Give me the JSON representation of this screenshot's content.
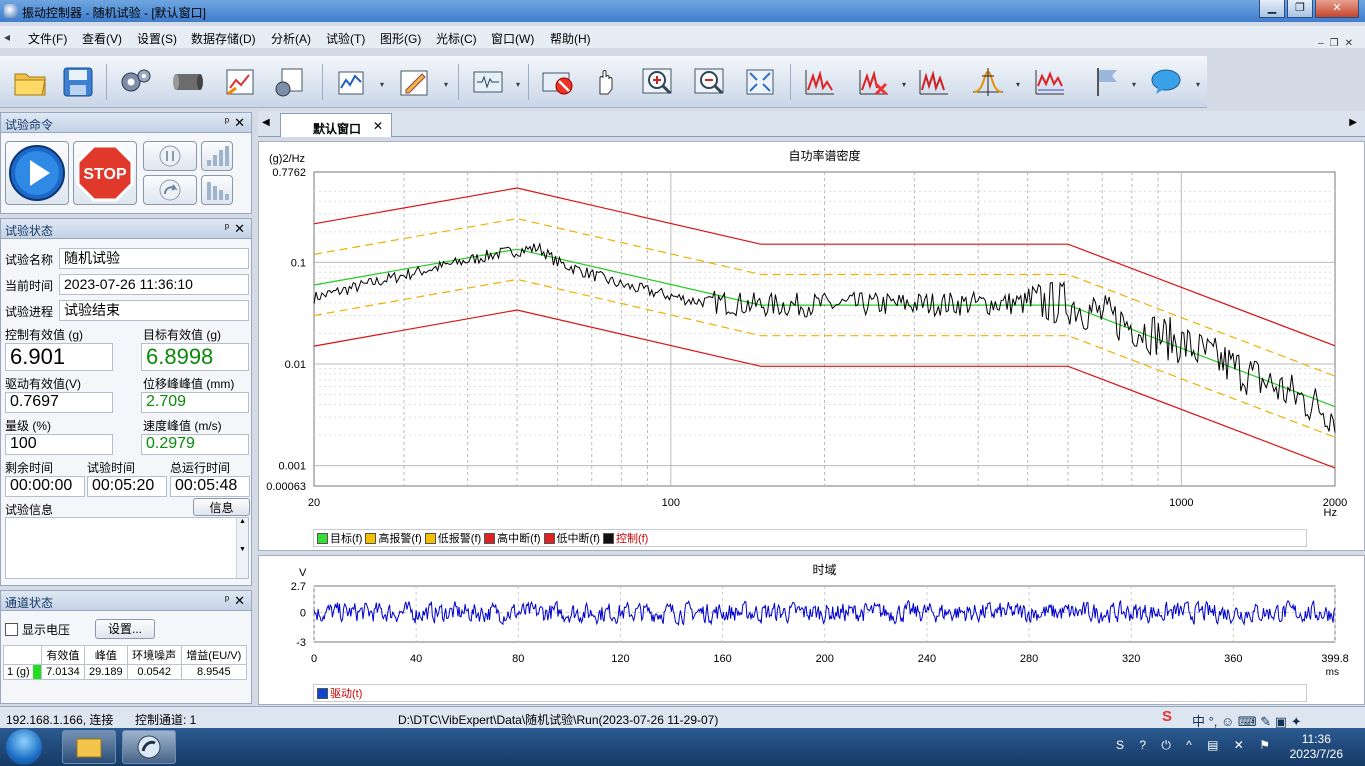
{
  "window": {
    "title": "振动控制器 - 随机试验 - [默认窗口]"
  },
  "menu": [
    "文件(F)",
    "查看(V)",
    "设置(S)",
    "数据存储(D)",
    "分析(A)",
    "试验(T)",
    "图形(G)",
    "光标(C)",
    "窗口(W)",
    "帮助(H)"
  ],
  "panels": {
    "cmd_title": "试验命令",
    "status_title": "试验状态",
    "channel_title": "通道状态"
  },
  "status": {
    "name_label": "试验名称",
    "name_value": "随机试验",
    "time_label": "当前时间",
    "time_value": "2023-07-26 11:36:10",
    "progress_label": "试验进程",
    "progress_value": "试验结束",
    "ctrl_rms_label": "控制有效值 (g)",
    "ctrl_rms_value": "6.901",
    "target_rms_label": "目标有效值 (g)",
    "target_rms_value": "6.8998",
    "drive_rms_label": "驱动有效值(V)",
    "drive_rms_value": "0.7697",
    "disp_label": "位移峰峰值 (mm)",
    "disp_value": "2.709",
    "level_label": "量级 (%)",
    "level_value": "100",
    "vel_label": "速度峰值 (m/s)",
    "vel_value": "0.2979",
    "remain_label": "剩余时间",
    "remain_value": "00:00:00",
    "test_time_label": "试验时间",
    "test_time_value": "00:05:20",
    "total_label": "总运行时间",
    "total_value": "00:05:48",
    "info_label": "试验信息",
    "info_button": "信息"
  },
  "channel": {
    "show_voltage": "显示电压",
    "settings_button": "设置...",
    "headers": [
      "",
      "有效值",
      "峰值",
      "环境噪声",
      "增益(EU/V)"
    ],
    "rows": [
      [
        "1 (g)",
        "7.0134",
        "29.189",
        "0.0542",
        "8.9545"
      ]
    ]
  },
  "doc": {
    "tab": "默认窗口"
  },
  "chart_data": [
    {
      "type": "line",
      "title": "自功率谱密度",
      "ylabel": "(g)2/Hz",
      "xlabel": "Hz",
      "xscale": "log",
      "yscale": "log",
      "xlim": [
        20,
        2000
      ],
      "ylim": [
        0.00063,
        0.7762
      ],
      "x_ticks": [
        "20",
        "100",
        "1000",
        "2000"
      ],
      "y_ticks": [
        "0.7762",
        "0.1",
        "0.01",
        "0.001",
        "0.00063"
      ],
      "series": [
        {
          "name": "目标(f)",
          "color": "#22cc22",
          "points": [
            [
              20,
              0.06
            ],
            [
              50,
              0.135
            ],
            [
              150,
              0.038
            ],
            [
              600,
              0.038
            ],
            [
              2000,
              0.0038
            ]
          ]
        },
        {
          "name": "高报警(f)",
          "color": "#f0b000",
          "dashed": true,
          "points": [
            [
              20,
              0.12
            ],
            [
              50,
              0.27
            ],
            [
              150,
              0.076
            ],
            [
              600,
              0.076
            ],
            [
              2000,
              0.0076
            ]
          ]
        },
        {
          "name": "低报警(f)",
          "color": "#f0b000",
          "dashed": true,
          "points": [
            [
              20,
              0.03
            ],
            [
              50,
              0.068
            ],
            [
              150,
              0.019
            ],
            [
              600,
              0.019
            ],
            [
              2000,
              0.0019
            ]
          ]
        },
        {
          "name": "高中断(f)",
          "color": "#dd1111",
          "points": [
            [
              20,
              0.24
            ],
            [
              50,
              0.54
            ],
            [
              150,
              0.151
            ],
            [
              600,
              0.151
            ],
            [
              2000,
              0.0151
            ]
          ]
        },
        {
          "name": "低中断(f)",
          "color": "#dd1111",
          "points": [
            [
              20,
              0.015
            ],
            [
              50,
              0.034
            ],
            [
              150,
              0.0095
            ],
            [
              600,
              0.0095
            ],
            [
              2000,
              0.00095
            ]
          ]
        },
        {
          "name": "控制(f)",
          "color": "#000000",
          "noise": true,
          "points": [
            [
              20,
              0.045
            ],
            [
              30,
              0.075
            ],
            [
              45,
              0.12
            ],
            [
              55,
              0.14
            ],
            [
              60,
              0.1
            ],
            [
              80,
              0.06
            ],
            [
              110,
              0.042
            ],
            [
              150,
              0.038
            ],
            [
              600,
              0.04
            ],
            [
              1000,
              0.016
            ],
            [
              2000,
              0.0032
            ]
          ]
        }
      ]
    },
    {
      "type": "line",
      "title": "时域",
      "ylabel": "V",
      "xlabel": "ms",
      "xlim": [
        0,
        399.8
      ],
      "ylim": [
        -3,
        2.7
      ],
      "x_ticks": [
        "0",
        "40",
        "80",
        "120",
        "160",
        "200",
        "240",
        "280",
        "320",
        "360",
        "399.8"
      ],
      "y_ticks": [
        "2.7",
        "0",
        "-3"
      ],
      "series": [
        {
          "name": "驱动(t)",
          "color": "#0000cc",
          "rms": 0.7697
        }
      ]
    }
  ],
  "statusbar": {
    "ip": "192.168.1.166, 连接",
    "ctrl_channel": "控制通道: 1",
    "path": "D:\\DTC\\VibExpert\\Data\\随机试验\\Run(2023-07-26 11-29-07)"
  },
  "taskbar": {
    "time": "11:36",
    "date": "2023/7/26"
  }
}
